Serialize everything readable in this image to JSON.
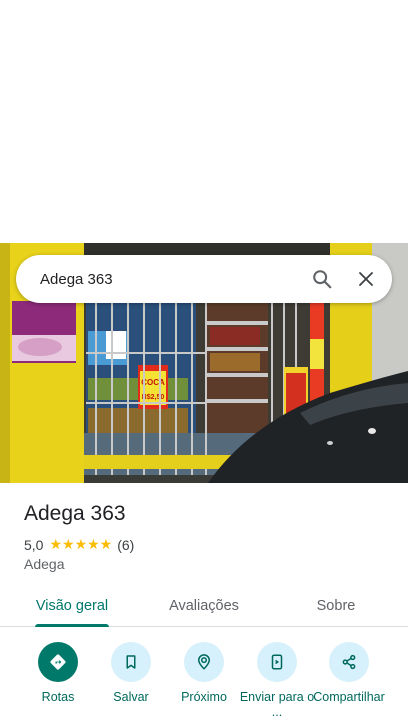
{
  "search": {
    "query": "Adega 363"
  },
  "photo_signs": {
    "price_a": "COCA",
    "price_b": "R$2,50"
  },
  "place": {
    "title": "Adega 363",
    "rating": "5,0",
    "stars": "★★★★★",
    "reviews": "(6)",
    "category": "Adega"
  },
  "tabs": [
    {
      "label": "Visão geral"
    },
    {
      "label": "Avaliações"
    },
    {
      "label": "Sobre"
    }
  ],
  "actions": [
    {
      "label": "Rotas"
    },
    {
      "label": "Salvar"
    },
    {
      "label": "Próximo"
    },
    {
      "label": "Enviar para o ..."
    },
    {
      "label": "Compartilhar"
    }
  ],
  "colors": {
    "accent": "#00796b",
    "action_bg": "#d6f1fb",
    "star": "#fbbc04"
  }
}
